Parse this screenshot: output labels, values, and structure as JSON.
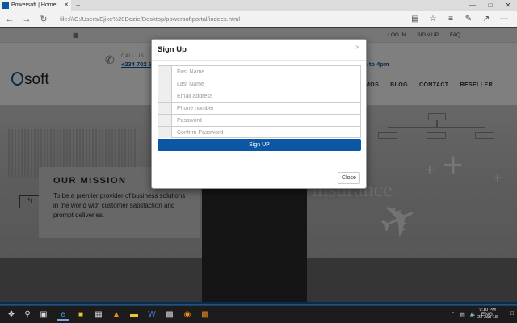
{
  "browser": {
    "tab_title": "Powersoft | Home",
    "tab_close": "✕",
    "new_tab": "+",
    "url": "file:///C:/Users/Ejike%20Dozie/Desktop/powersoftportal/indeex.html",
    "nav_icons": [
      "back-icon",
      "forward-icon",
      "refresh-icon"
    ],
    "tool_icons": [
      "reading-view-icon",
      "favorite-icon",
      "hub-icon",
      "notes-icon",
      "share-icon",
      "more-icon"
    ]
  },
  "site": {
    "top_links": [
      "LOG IN",
      "SIGN UP",
      "FAQ"
    ],
    "call_us_label": "CALL US",
    "phone": "+234 702 5",
    "hours": "am to 4pm",
    "logo_text": "soft",
    "nav": [
      "MOS",
      "BLOG",
      "CONTACT",
      "RESELLER"
    ],
    "hero_word": "insurance",
    "mission_title": "OUR MISSION",
    "mission_text": "To be a premier provider of business solutions in the world with customer satisfaction and prompt deliveries."
  },
  "modal": {
    "title": "Sign Up",
    "close_x": "×",
    "fields": [
      {
        "name": "first-name-input",
        "placeholder": "First Name",
        "value": ""
      },
      {
        "name": "last-name-input",
        "placeholder": "Last Name",
        "value": ""
      },
      {
        "name": "email-input",
        "placeholder": "Email address",
        "value": ""
      },
      {
        "name": "phone-input",
        "placeholder": "Phone number",
        "value": ""
      },
      {
        "name": "password-input",
        "placeholder": "Password",
        "value": ""
      },
      {
        "name": "confirm-password-input",
        "placeholder": "Confirm Password",
        "value": ""
      }
    ],
    "submit_label": "Sign UP",
    "close_label": "Close"
  },
  "taskbar": {
    "apps": [
      "windows-start-icon",
      "search-icon",
      "edge-icon",
      "file-explorer-icon",
      "store-icon",
      "vlc-icon",
      "folder-icon",
      "word-icon",
      "terminal-icon",
      "app-icon",
      "settings-app-icon",
      "paint-icon"
    ],
    "language": "ENG",
    "time": "9:10 PM",
    "date": "22-Jan-18"
  },
  "colors": {
    "brand_blue": "#0b57a4",
    "overlay": "rgba(0,0,0,0.5)"
  }
}
